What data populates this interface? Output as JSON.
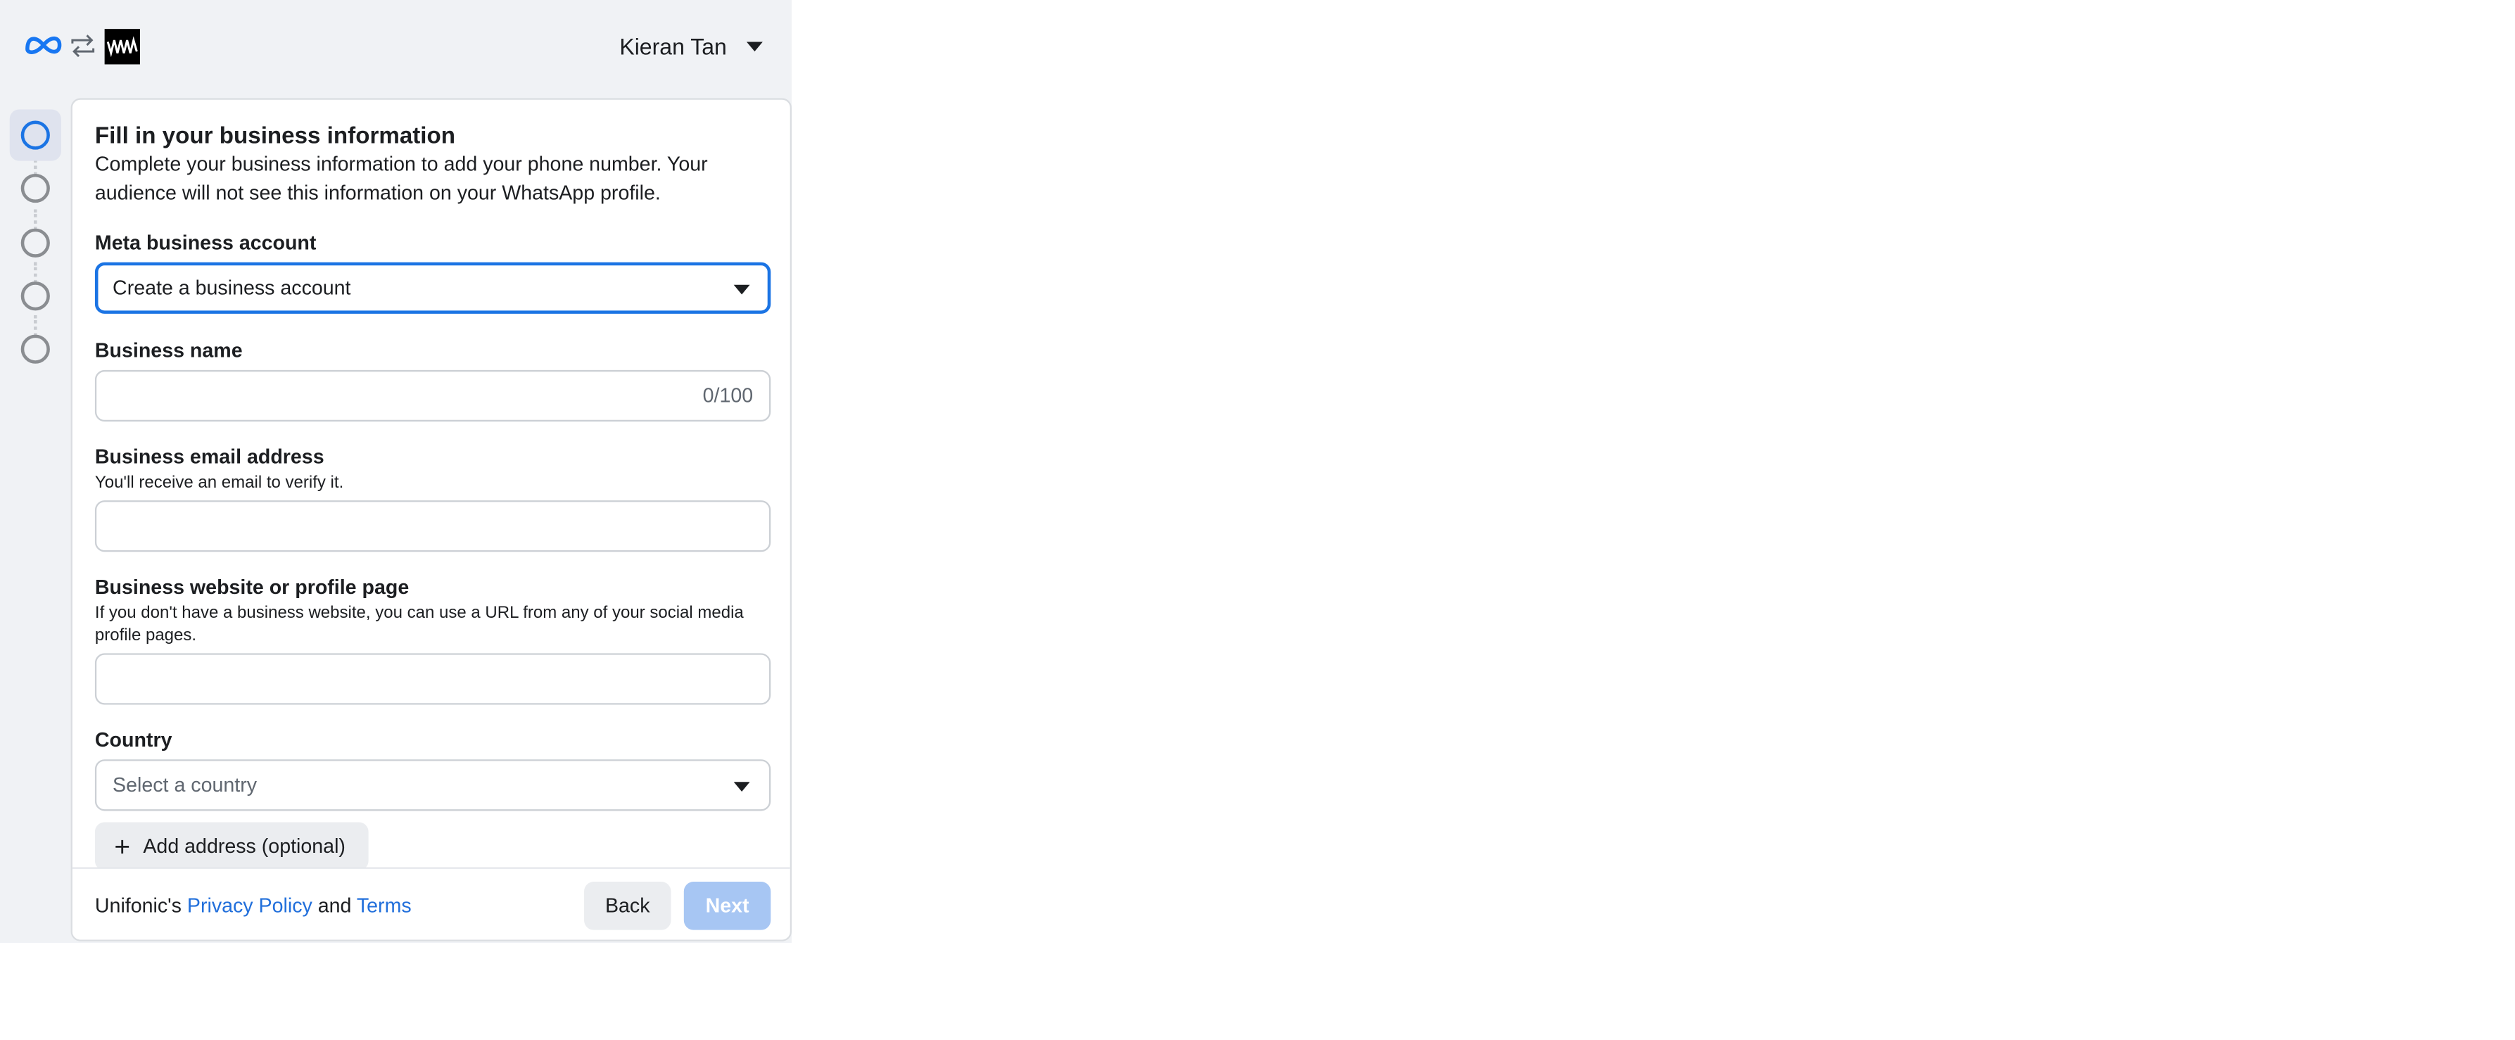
{
  "header": {
    "meta_logo_icon": "meta-infinity-icon",
    "switch_icon": "swap-arrows-icon",
    "partner_logo_icon": "unifonic-logo-icon",
    "user_name": "Kieran Tan",
    "user_menu_icon": "chevron-down-icon"
  },
  "stepper": {
    "steps": [
      {
        "state": "active"
      },
      {
        "state": "pending"
      },
      {
        "state": "pending"
      },
      {
        "state": "pending"
      },
      {
        "state": "pending"
      }
    ]
  },
  "form": {
    "title": "Fill in your business information",
    "description": "Complete your business information to add your phone number. Your audience will not see this information on your WhatsApp profile.",
    "meta_account": {
      "label": "Meta business account",
      "value": "Create a business account"
    },
    "business_name": {
      "label": "Business name",
      "value": "",
      "counter": "0/100"
    },
    "business_email": {
      "label": "Business email address",
      "helper": "You'll receive an email to verify it.",
      "value": ""
    },
    "website": {
      "label": "Business website or profile page",
      "helper": "If you don't have a business website, you can use a URL from any of your social media profile pages.",
      "value": ""
    },
    "country": {
      "label": "Country",
      "placeholder": "Select a country"
    },
    "add_address": {
      "icon": "plus-icon",
      "label": "Add address (optional)"
    }
  },
  "footer": {
    "legal_prefix": "Unifonic's",
    "privacy_link": "Privacy Policy",
    "conjunction": "and",
    "terms_link": "Terms",
    "back_label": "Back",
    "next_label": "Next"
  },
  "colors": {
    "accent": "#1b74e4",
    "link": "#216fdb",
    "next_disabled": "#a7c6f3",
    "panel_bg": "#f0f2f5"
  }
}
